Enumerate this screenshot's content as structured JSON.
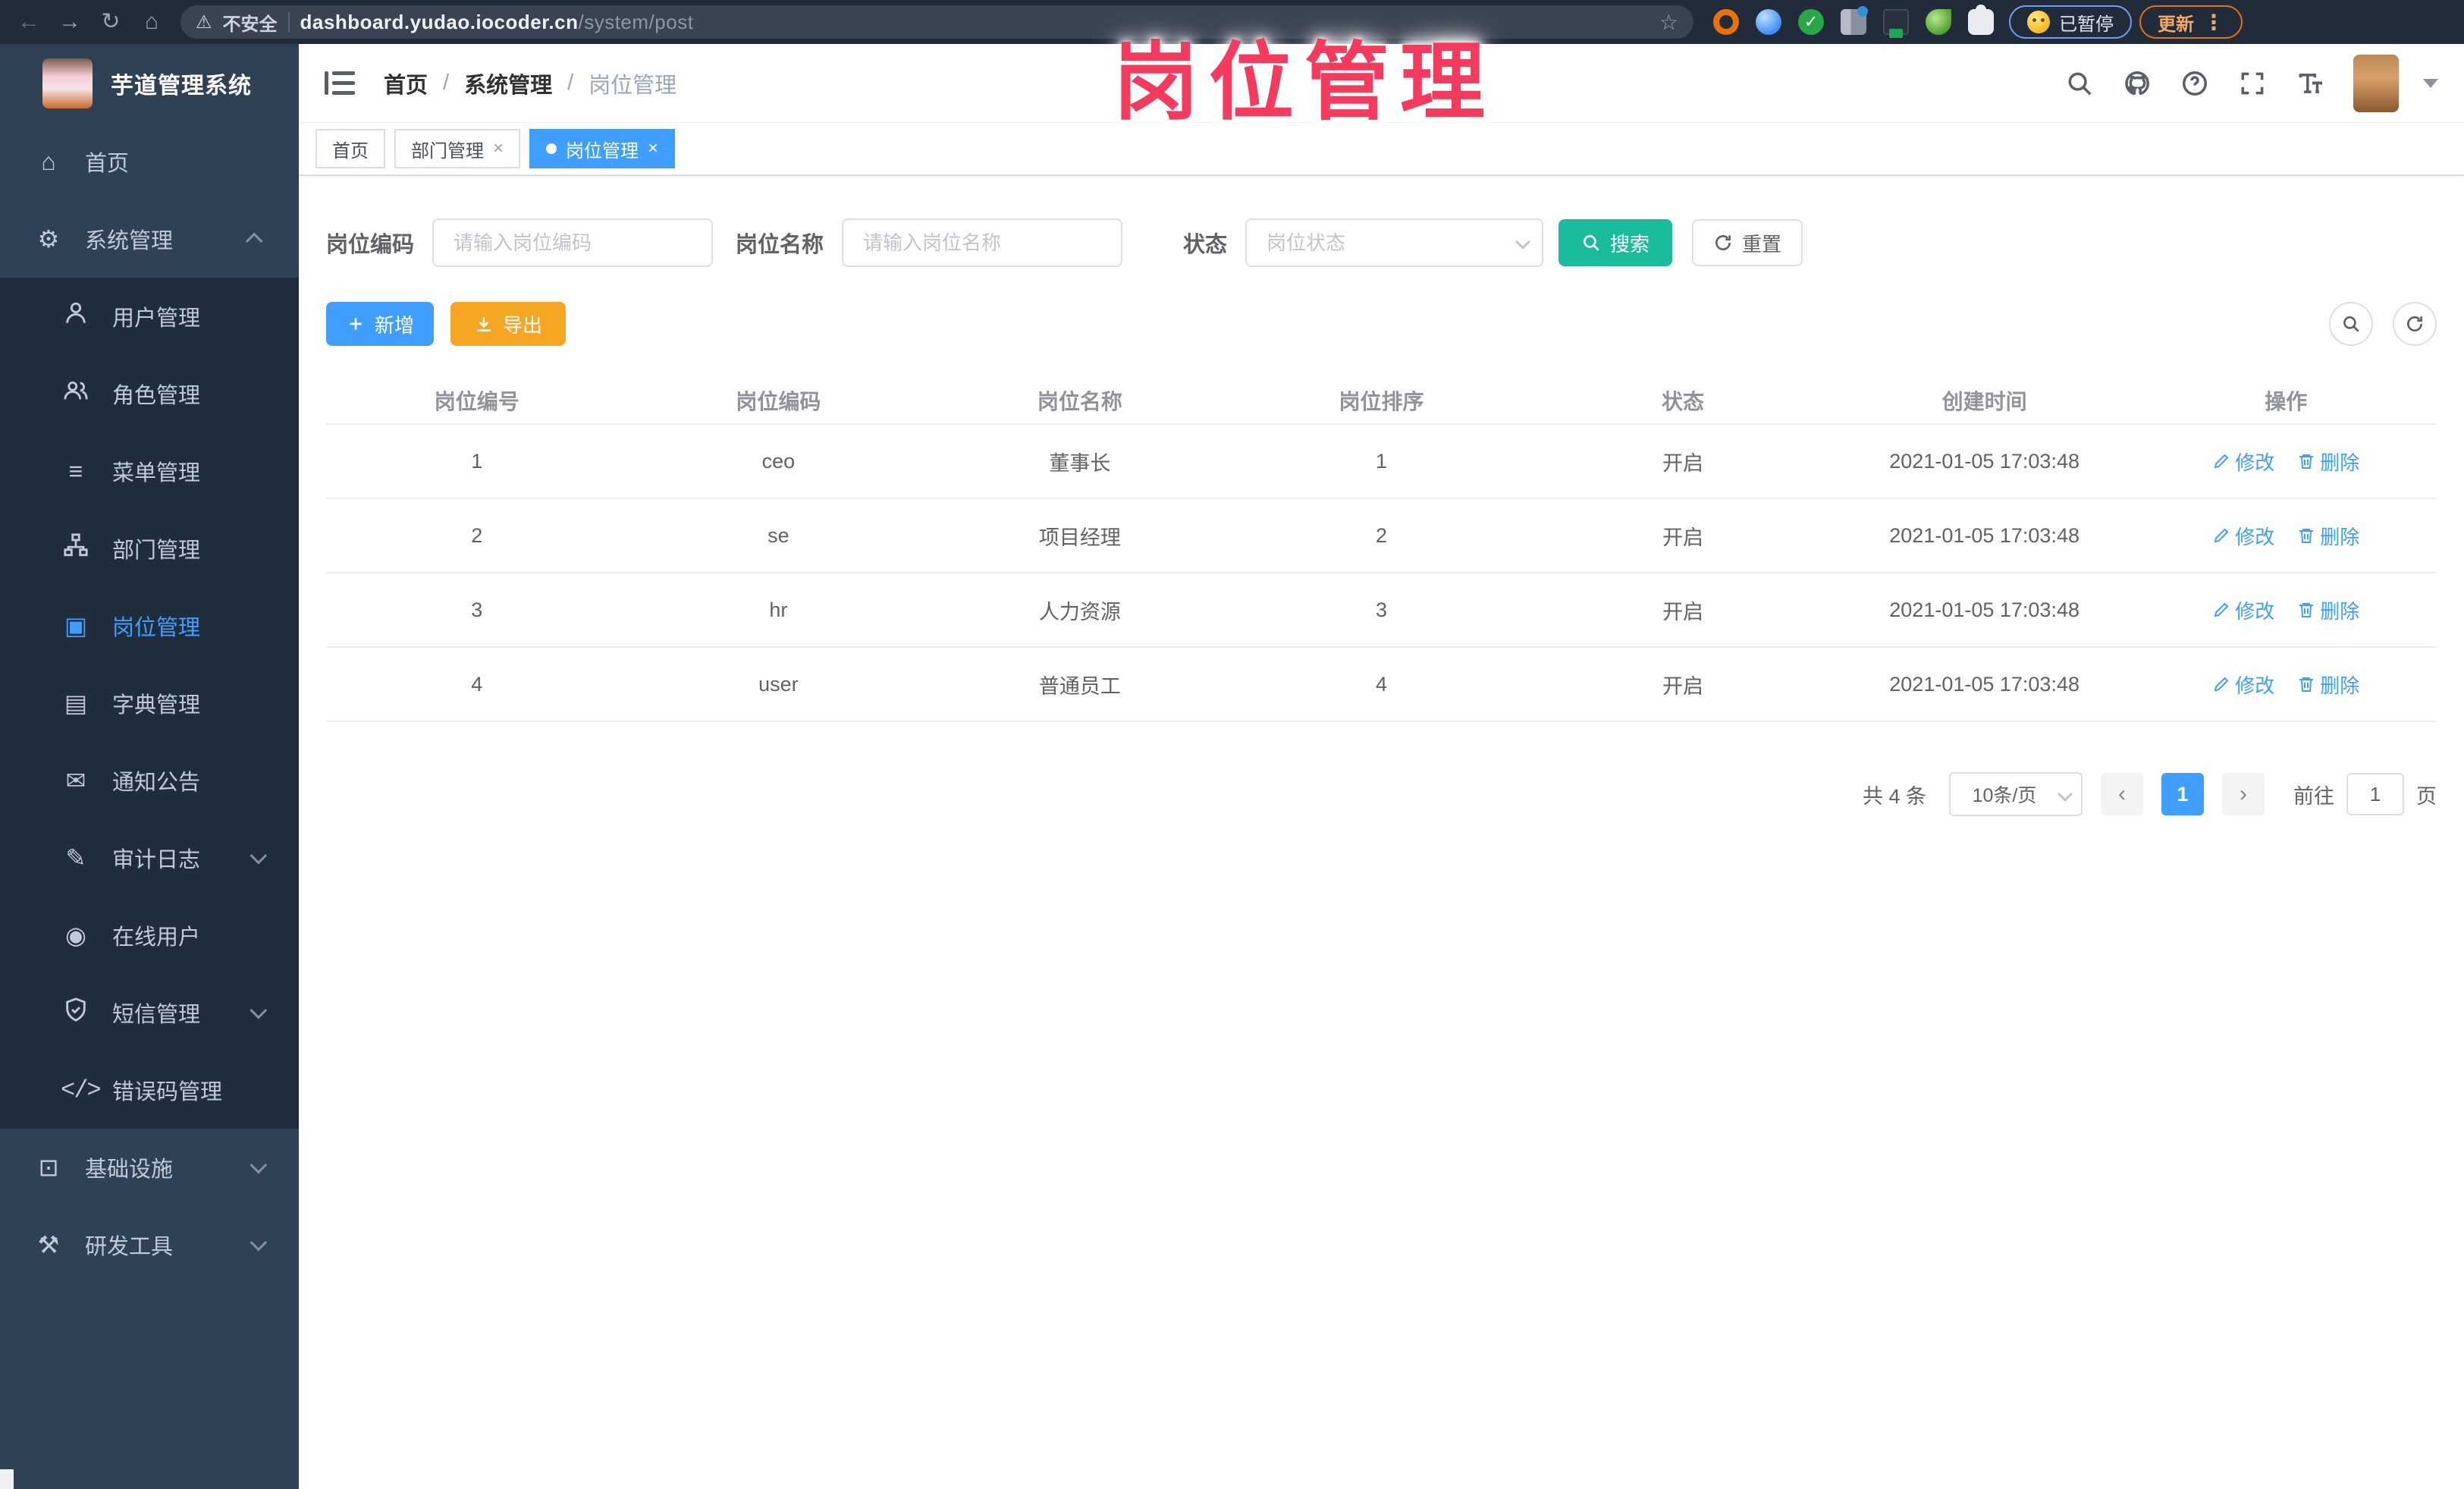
{
  "browser": {
    "security_label": "不安全",
    "url_host": "dashboard.yudao.iocoder.cn",
    "url_path": "/system/post",
    "paused_button": "已暂停",
    "update_button": "更新"
  },
  "annotation": {
    "title": "岗位管理"
  },
  "sidebar": {
    "app_title": "芋道管理系统",
    "items": [
      {
        "label": "首页"
      },
      {
        "label": "系统管理",
        "expanded": true
      },
      {
        "label": "用户管理"
      },
      {
        "label": "角色管理"
      },
      {
        "label": "菜单管理"
      },
      {
        "label": "部门管理"
      },
      {
        "label": "岗位管理",
        "active": true
      },
      {
        "label": "字典管理"
      },
      {
        "label": "通知公告"
      },
      {
        "label": "审计日志"
      },
      {
        "label": "在线用户"
      },
      {
        "label": "短信管理"
      },
      {
        "label": "错误码管理"
      },
      {
        "label": "基础设施"
      },
      {
        "label": "研发工具"
      }
    ]
  },
  "breadcrumb": {
    "items": [
      "首页",
      "系统管理",
      "岗位管理"
    ]
  },
  "tabs": [
    {
      "label": "首页",
      "closable": false,
      "active": false
    },
    {
      "label": "部门管理",
      "closable": true,
      "active": false
    },
    {
      "label": "岗位管理",
      "closable": true,
      "active": true
    }
  ],
  "filters": {
    "code_label": "岗位编码",
    "code_placeholder": "请输入岗位编码",
    "name_label": "岗位名称",
    "name_placeholder": "请输入岗位名称",
    "status_label": "状态",
    "status_placeholder": "岗位状态",
    "search_button": "搜索",
    "reset_button": "重置"
  },
  "toolbar": {
    "add_button": "新增",
    "export_button": "导出"
  },
  "table": {
    "headers": [
      "岗位编号",
      "岗位编码",
      "岗位名称",
      "岗位排序",
      "状态",
      "创建时间",
      "操作"
    ],
    "rows": [
      {
        "id": "1",
        "code": "ceo",
        "name": "董事长",
        "sort": "1",
        "status": "开启",
        "created_at": "2021-01-05 17:03:48"
      },
      {
        "id": "2",
        "code": "se",
        "name": "项目经理",
        "sort": "2",
        "status": "开启",
        "created_at": "2021-01-05 17:03:48"
      },
      {
        "id": "3",
        "code": "hr",
        "name": "人力资源",
        "sort": "3",
        "status": "开启",
        "created_at": "2021-01-05 17:03:48"
      },
      {
        "id": "4",
        "code": "user",
        "name": "普通员工",
        "sort": "4",
        "status": "开启",
        "created_at": "2021-01-05 17:03:48"
      }
    ],
    "edit_label": "修改",
    "delete_label": "删除"
  },
  "pagination": {
    "total": "共 4 条",
    "page_size": "10条/页",
    "current_page": "1",
    "goto_label": "前往",
    "goto_value": "1",
    "unit_label": "页"
  },
  "glyphs": {
    "back": "←",
    "forward": "→",
    "reload": "↻",
    "home": "⌂",
    "warning": "⚠",
    "star": "☆",
    "kebab": "⋮",
    "close": "×",
    "menu_home": "⌂",
    "menu_gear": "⚙",
    "menu_list": "≡",
    "menu_post": "▣",
    "menu_dict": "▤",
    "menu_notice": "✉",
    "menu_audit": "✎",
    "menu_online": "◉",
    "menu_code": "</>",
    "menu_infra": "⊡",
    "menu_tool": "⚒",
    "prev": "‹",
    "next": "›"
  },
  "colors": {
    "accent": "#409EFF",
    "search_button": "#1ABC9C",
    "export_button": "#F5A623",
    "annotation": "#F43B5E",
    "sidebar_bg": "#304156",
    "submenu_bg": "#1F2D3D",
    "browser_bar_bg": "#212B3A"
  }
}
